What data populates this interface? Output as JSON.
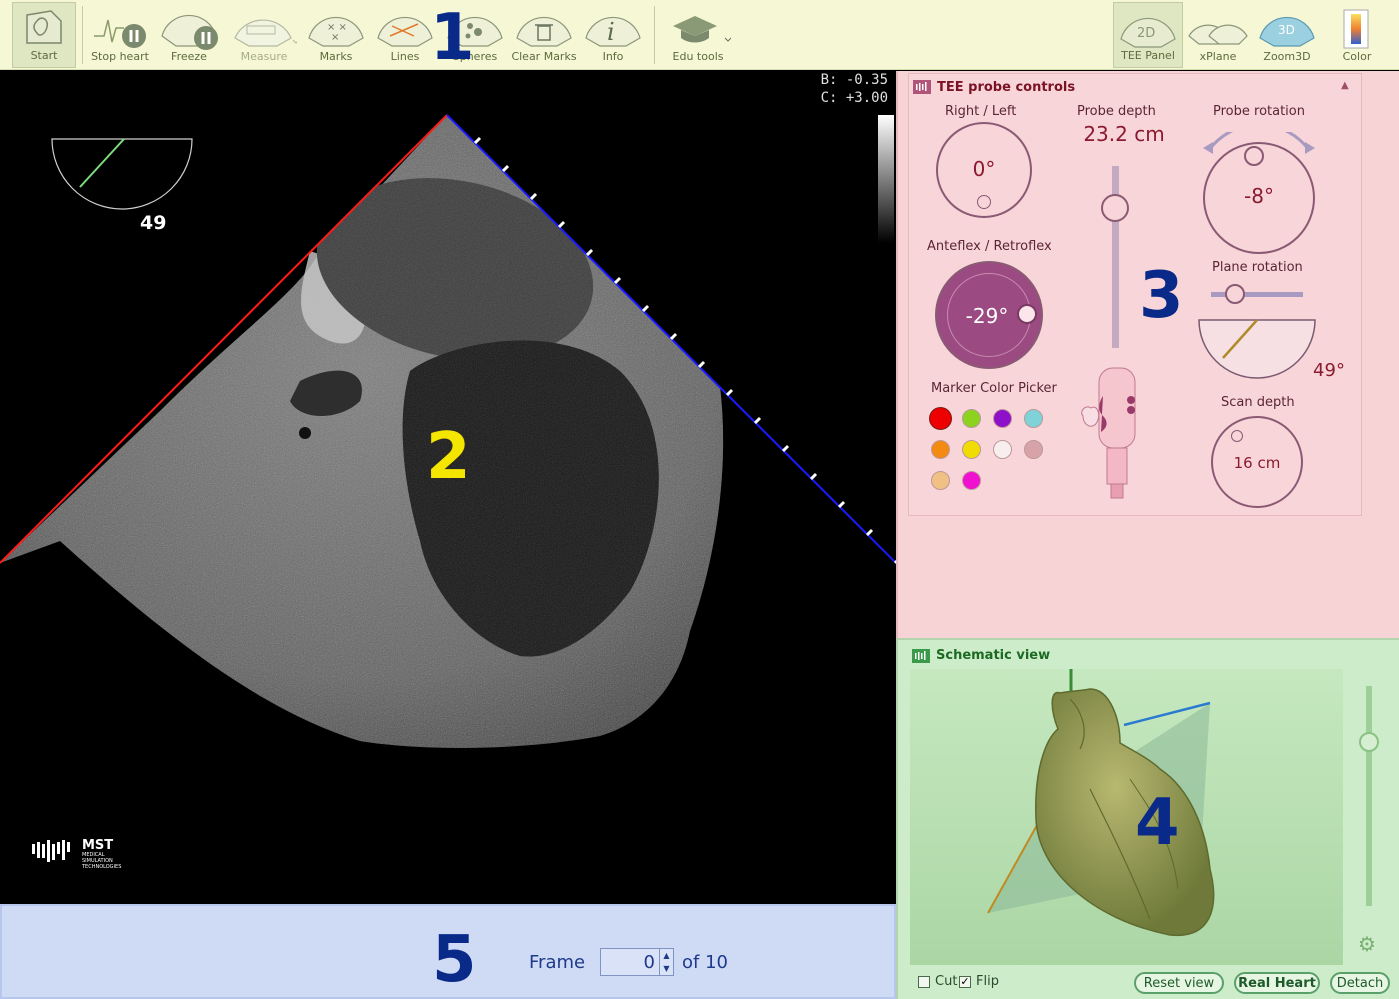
{
  "toolbar": {
    "items": [
      {
        "label": "Start",
        "icon": "heart-outline-icon",
        "active": true
      },
      {
        "label": "Stop heart",
        "icon": "stop-heart-icon"
      },
      {
        "label": "Freeze",
        "icon": "freeze-icon"
      },
      {
        "label": "Measure",
        "icon": "measure-icon",
        "disabled": true
      },
      {
        "label": "Marks",
        "icon": "marks-icon"
      },
      {
        "label": "Lines",
        "icon": "lines-icon"
      },
      {
        "label": "Spheres",
        "icon": "spheres-icon"
      },
      {
        "label": "Clear Marks",
        "icon": "clear-marks-icon"
      },
      {
        "label": "Info",
        "icon": "info-icon"
      },
      {
        "label": "Edu tools",
        "icon": "graduation-cap-icon"
      },
      {
        "label": "TEE Panel",
        "icon": "2d-icon",
        "icon_text": "2D",
        "active": true
      },
      {
        "label": "xPlane",
        "icon": "xplane-icon"
      },
      {
        "label": "Zoom3D",
        "icon": "3d-icon",
        "icon_text": "3D"
      },
      {
        "label": "Color",
        "icon": "color-icon"
      }
    ]
  },
  "annotations": {
    "n1": "1",
    "n2": "2",
    "n3": "3",
    "n4": "4",
    "n5": "5"
  },
  "ultrasound": {
    "readout_b": "B: -0.35",
    "readout_c": "C: +3.00",
    "mini_sector_angle": "49",
    "logo_text": "MST",
    "logo_sub": [
      "MEDICAL",
      "SIMULATION",
      "TECHNOLOGIES"
    ]
  },
  "frame": {
    "label": "Frame",
    "value": "0",
    "of": "of 10"
  },
  "tee": {
    "title": "TEE probe controls",
    "right_left": {
      "label": "Right / Left",
      "value": "0°"
    },
    "probe_depth": {
      "label": "Probe depth",
      "value": "23.2 cm"
    },
    "probe_rotation": {
      "label": "Probe rotation",
      "value": "-8°"
    },
    "anteflex": {
      "label": "Anteflex / Retroflex",
      "value": "-29°"
    },
    "plane_rotation": {
      "label": "Plane rotation",
      "value": "49°"
    },
    "marker_color_picker": {
      "label": "Marker Color Picker",
      "colors": [
        "#ee0000",
        "#8cd21e",
        "#8e10c8",
        "#7fd3d8",
        "#f58a12",
        "#f0dc00",
        "#f8eeee",
        "#d8a3a8",
        "#f0c084",
        "#f010d0"
      ]
    },
    "scan_depth": {
      "label": "Scan depth",
      "value": "16 cm"
    }
  },
  "schematic": {
    "title": "Schematic view",
    "cut_label": "Cut",
    "cut_checked": false,
    "flip_label": "Flip",
    "flip_checked": true,
    "reset_label": "Reset view",
    "real_heart_label": "Real Heart",
    "detach_label": "Detach"
  }
}
